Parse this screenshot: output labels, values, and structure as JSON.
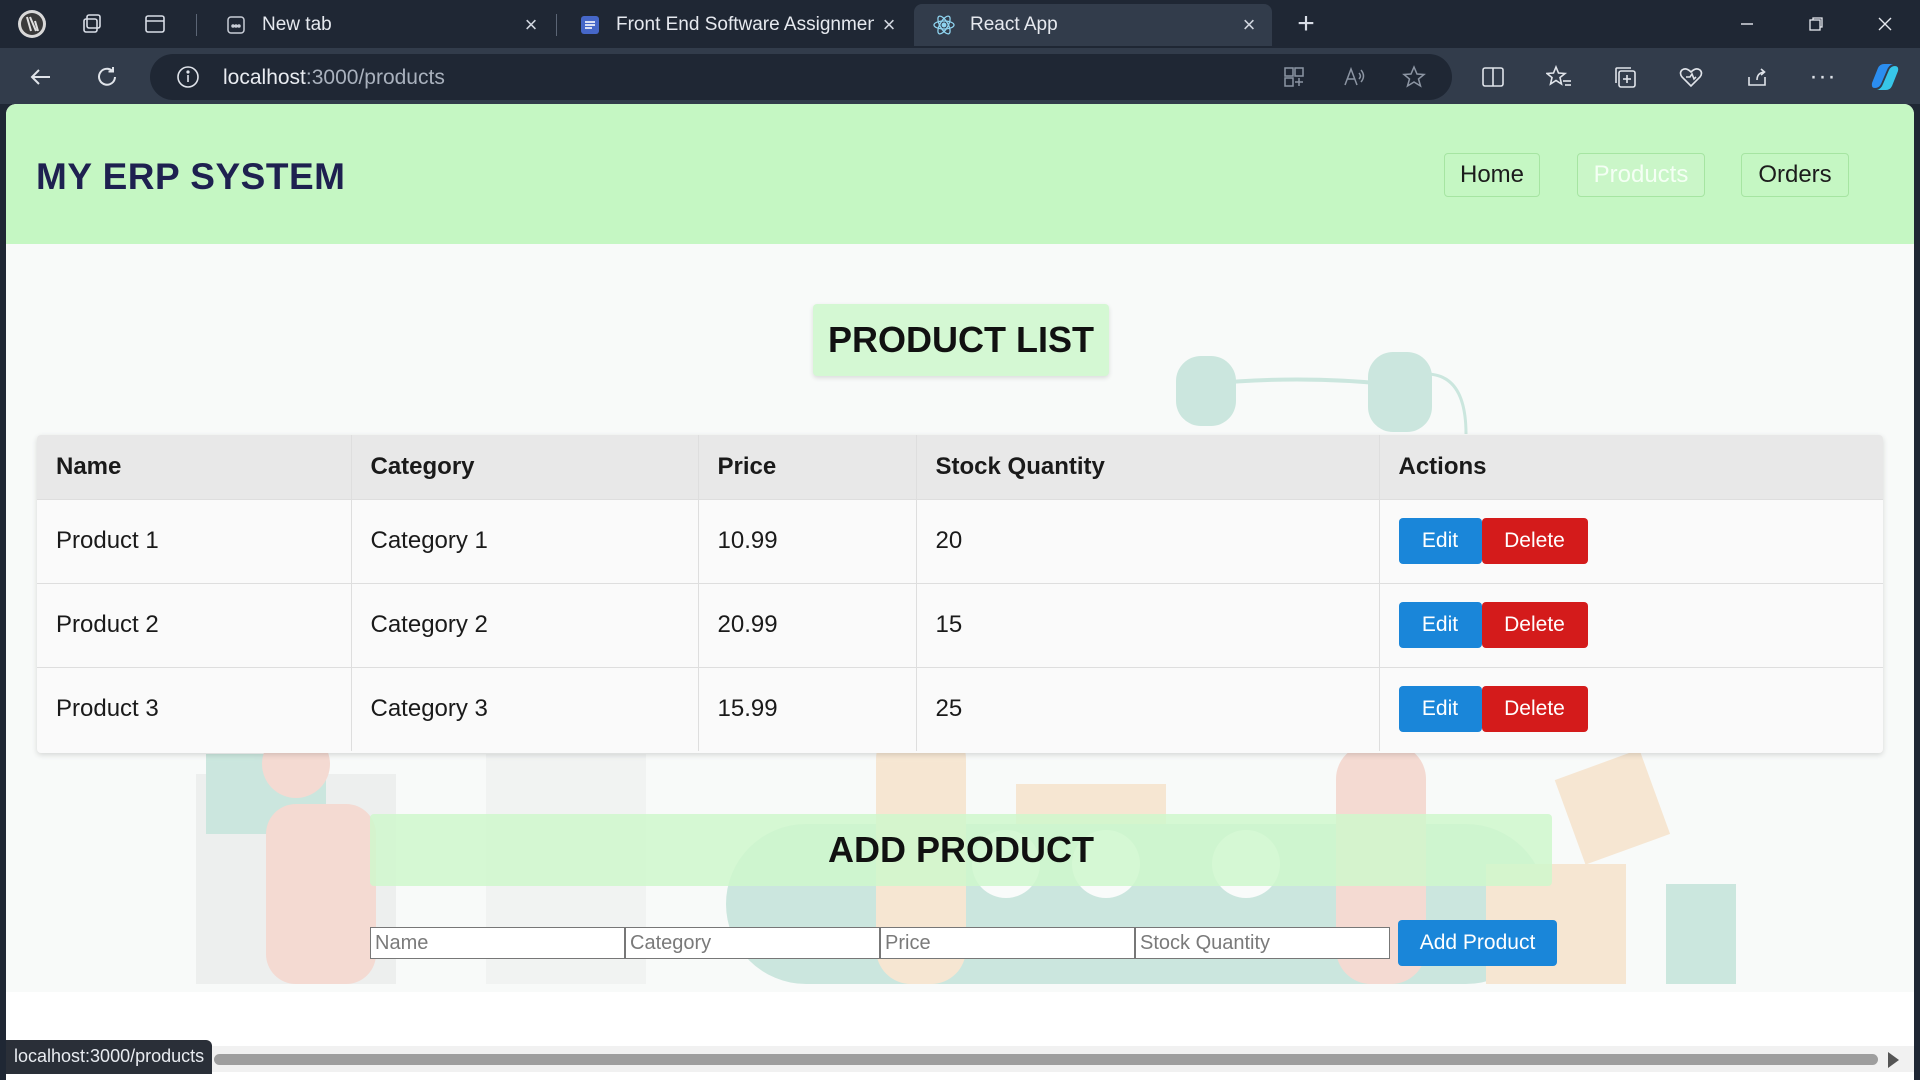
{
  "browser": {
    "tabs": [
      {
        "title": "New tab"
      },
      {
        "title": "Front End Software Assignment:"
      },
      {
        "title": "React App"
      }
    ],
    "url_host": "localhost",
    "url_rest": ":3000/products",
    "status_url": "localhost:3000/products"
  },
  "header": {
    "brand": "MY ERP SYSTEM",
    "nav": {
      "home": "Home",
      "products": "Products",
      "orders": "Orders"
    }
  },
  "product_list": {
    "title": "PRODUCT LIST",
    "columns": [
      "Name",
      "Category",
      "Price",
      "Stock Quantity",
      "Actions"
    ],
    "rows": [
      {
        "name": "Product 1",
        "category": "Category 1",
        "price": "10.99",
        "stock": "20"
      },
      {
        "name": "Product 2",
        "category": "Category 2",
        "price": "20.99",
        "stock": "15"
      },
      {
        "name": "Product 3",
        "category": "Category 3",
        "price": "15.99",
        "stock": "25"
      }
    ],
    "edit_label": "Edit",
    "delete_label": "Delete"
  },
  "add_product": {
    "title": "ADD PRODUCT",
    "name_placeholder": "Name",
    "category_placeholder": "Category",
    "price_placeholder": "Price",
    "stock_placeholder": "Stock Quantity",
    "button_label": "Add Product"
  },
  "colors": {
    "header_bg": "#c5f7c3",
    "brand_text": "#1e2150",
    "edit_button": "#1a86d9",
    "delete_button": "#d41b1b"
  }
}
